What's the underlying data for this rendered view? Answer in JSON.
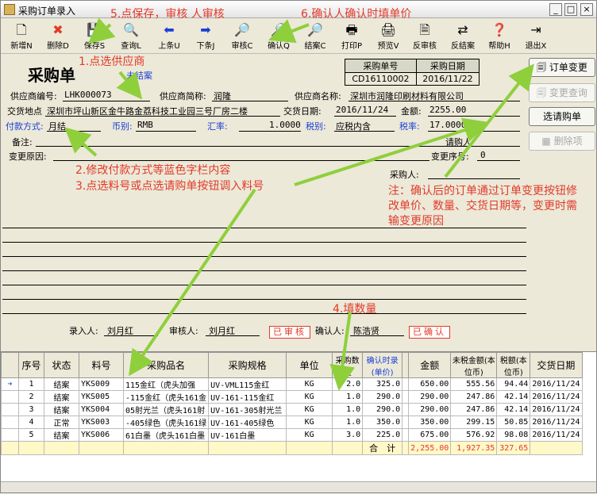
{
  "window": {
    "title": "采购订单录入"
  },
  "toolbar": [
    {
      "name": "new",
      "label": "新增N",
      "icon": "document-icon"
    },
    {
      "name": "delete",
      "label": "删除D",
      "icon": "delete-icon"
    },
    {
      "name": "save",
      "label": "保存S",
      "icon": "save-icon"
    },
    {
      "name": "query",
      "label": "查询L",
      "icon": "query-icon"
    },
    {
      "name": "prev",
      "label": "上条U",
      "icon": "arrow-left-icon"
    },
    {
      "name": "next",
      "label": "下条J",
      "icon": "arrow-right-icon"
    },
    {
      "name": "review",
      "label": "审核C",
      "icon": "magnifier-icon"
    },
    {
      "name": "confirm",
      "label": "确认Q",
      "icon": "magnifier-icon"
    },
    {
      "name": "close",
      "label": "结案C",
      "icon": "magnifier-icon"
    },
    {
      "name": "print",
      "label": "打印P",
      "icon": "printer-icon"
    },
    {
      "name": "preview",
      "label": "预览V",
      "icon": "preview-icon"
    },
    {
      "name": "unreview",
      "label": "反审核",
      "icon": "unreview-icon"
    },
    {
      "name": "unclose",
      "label": "反结案",
      "icon": "unclose-icon"
    },
    {
      "name": "help",
      "label": "帮助H",
      "icon": "help-icon"
    },
    {
      "name": "exit",
      "label": "退出X",
      "icon": "exit-icon"
    }
  ],
  "annotations": {
    "a5": "5.点保存，审核 人审核",
    "a6": "6.确认人确认时填单价",
    "a1": "1.点选供应商",
    "a2": "2.修改付款方式等蓝色字栏内容",
    "a3": "3.点选料号或点选请购单按钮调入料号",
    "note": "注：确认后的订单通过订单变更按钮修改单价、数量、交货日期等，变更时需输变更原因",
    "a4": "4.填数量"
  },
  "header": {
    "title": "采购单",
    "status": "未结案",
    "order_no_label": "采购单号",
    "order_date_label": "采购日期",
    "order_no": "CD16110002",
    "order_date": "2016/11/22"
  },
  "form": {
    "supplier_code_label": "供应商编号:",
    "supplier_code": "LHK000073",
    "supplier_short_label": "供应商简称:",
    "supplier_short": "润隆",
    "supplier_name_label": "供应商名称:",
    "supplier_name": "深圳市润隆印刷材料有限公司",
    "delivery_place_label": "交货地点",
    "delivery_place": "深圳市坪山新区金牛路金荔科技工业园三号厂房二楼",
    "delivery_date_label": "交货日期:",
    "delivery_date": "2016/11/24",
    "amount_label": "金额:",
    "amount": "2255.00",
    "payment_label": "付款方式:",
    "payment": "月结",
    "currency_label": "币别:",
    "currency": "RMB",
    "rate_label": "汇率:",
    "rate": "1.0000",
    "tax_type_label": "税别:",
    "tax_type": "应税内含",
    "tax_rate_label": "税率:",
    "tax_rate": "17.0000",
    "remark_label": "备注:",
    "requester_label": "请购人",
    "change_reason_label": "变更原因:",
    "change_no_label": "变更序号:",
    "change_no": "0",
    "buyer_label": "采购人:",
    "entered_by_label": "录入人:",
    "entered_by": "刘月红",
    "reviewer_label": "审核人:",
    "reviewer": "刘月红",
    "reviewed_stamp": "已审核",
    "confirmer_label": "确认人:",
    "confirmer": "陈浩贤",
    "confirmed_stamp": "已确认"
  },
  "side_buttons": {
    "order_change": "订单变更",
    "change_query": "变更查询",
    "select_request": "选请购单",
    "delete_item": "删除项"
  },
  "table": {
    "columns": [
      "序号",
      "状态",
      "料号",
      "采购品名",
      "采购规格",
      "单位",
      "采购数量",
      "确认时录(单价)",
      "",
      "金额",
      "未税金额(本位币)",
      "税额(本位币)",
      "交货日期"
    ],
    "rows": [
      {
        "seq": "1",
        "status": "结案",
        "code": "YKS009",
        "name": "115金红（虎头加强",
        "spec": "UV-VML115金红",
        "unit": "KG",
        "qty": "2.0",
        "price": "325.0",
        "amount": "650.00",
        "net": "555.56",
        "tax": "94.44",
        "date": "2016/11/24"
      },
      {
        "seq": "2",
        "status": "结案",
        "code": "YKS005",
        "name": "-115金红（虎头161金",
        "spec": "UV-161-115金红",
        "unit": "KG",
        "qty": "1.0",
        "price": "290.0",
        "amount": "290.00",
        "net": "247.86",
        "tax": "42.14",
        "date": "2016/11/24"
      },
      {
        "seq": "3",
        "status": "结案",
        "code": "YKS004",
        "name": "05射光兰（虎头161射",
        "spec": "UV-161-305射光兰",
        "unit": "KG",
        "qty": "1.0",
        "price": "290.0",
        "amount": "290.00",
        "net": "247.86",
        "tax": "42.14",
        "date": "2016/11/24"
      },
      {
        "seq": "4",
        "status": "正常",
        "code": "YKS003",
        "name": "-405绿色（虎头161绿",
        "spec": "UV-161-405绿色",
        "unit": "KG",
        "qty": "1.0",
        "price": "350.0",
        "amount": "350.00",
        "net": "299.15",
        "tax": "50.85",
        "date": "2016/11/24"
      },
      {
        "seq": "5",
        "status": "结案",
        "code": "YKS006",
        "name": "61白墨（虎头161白墨",
        "spec": "UV-161白墨",
        "unit": "KG",
        "qty": "3.0",
        "price": "225.0",
        "amount": "675.00",
        "net": "576.92",
        "tax": "98.08",
        "date": "2016/11/24"
      }
    ],
    "total_label": "合　计",
    "total_amount": "2,255.00",
    "total_net": "1,927.35",
    "total_tax": "327.65"
  },
  "colors": {
    "annotation": "#e23a2a",
    "arrow": "#8fcf3c",
    "highlight_row": "#fff8c8"
  }
}
